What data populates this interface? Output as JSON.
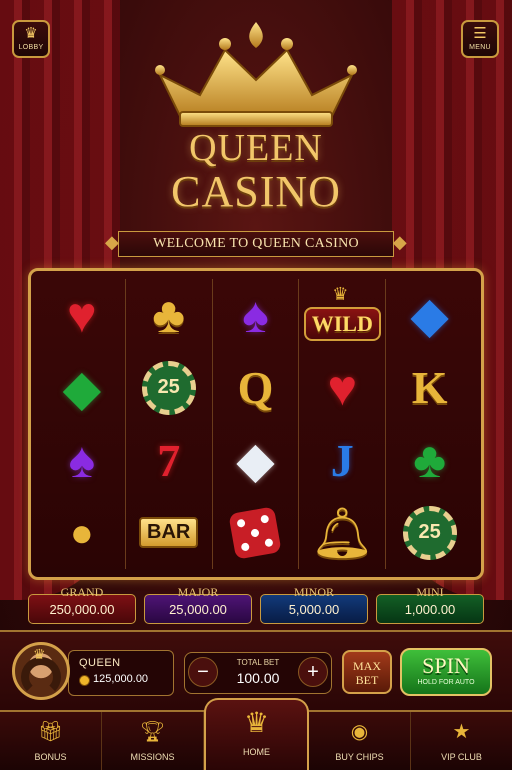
{
  "header": {
    "lobby_label": "LOBBY",
    "menu_label": "MENU",
    "title_line1": "QUEEN",
    "title_line2": "CASINO",
    "welcome": "WELCOME TO QUEEN CASINO"
  },
  "reels": [
    [
      "heart-gem",
      "diamond-gem-green",
      "spade-gem-purple",
      "coin-stack"
    ],
    [
      "club-gold",
      "chip-25",
      "seven",
      "bar"
    ],
    [
      "spade-gem-purple",
      "queen",
      "diamond-white",
      "dice"
    ],
    [
      "wild",
      "heart-gem",
      "jack",
      "bell"
    ],
    [
      "diamond-gem-blue",
      "king",
      "club-green",
      "chip-25"
    ]
  ],
  "symbols": {
    "wild_text": "WILD",
    "chip_value": "25",
    "bar_text": "BAR",
    "queen_letter": "Q",
    "king_letter": "K",
    "jack_letter": "J",
    "seven": "7"
  },
  "jackpots": {
    "grand": {
      "name": "GRAND",
      "value": "250,000.00"
    },
    "major": {
      "name": "MAJOR",
      "value": "25,000.00"
    },
    "minor": {
      "name": "MINOR",
      "value": "5,000.00"
    },
    "mini": {
      "name": "MINI",
      "value": "1,000.00"
    }
  },
  "player": {
    "name": "QUEEN",
    "balance": "125,000.00"
  },
  "bet": {
    "label": "TOTAL BET",
    "value": "100.00",
    "minus": "−",
    "plus": "+"
  },
  "max_bet": {
    "line1": "MAX",
    "line2": "BET"
  },
  "spin": {
    "label": "SPIN",
    "sub": "HOLD FOR AUTO"
  },
  "nav": {
    "bonus": "BONUS",
    "missions": "MISSIONS",
    "home": "HOME",
    "buy_chips": "BUY CHIPS",
    "vip_club": "VIP CLUB"
  },
  "colors": {
    "gold": "#e8b53a",
    "background": "#3a0b0b",
    "spin_green": "#2ea02a"
  }
}
